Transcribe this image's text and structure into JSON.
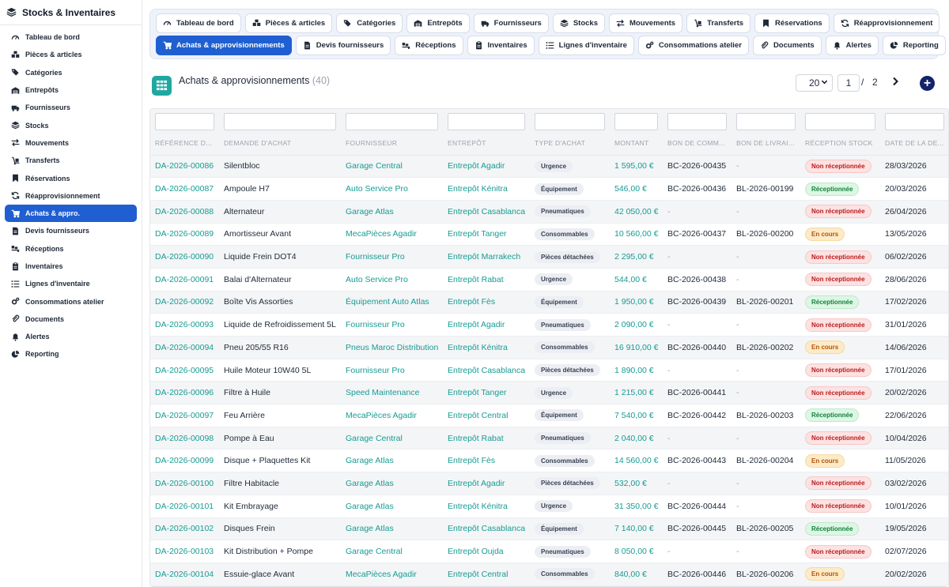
{
  "sidebar": {
    "title": "Stocks & Inventaires",
    "items": [
      {
        "label": "Tableau de bord",
        "icon": "gauge-icon",
        "active": false
      },
      {
        "label": "Pièces & articles",
        "icon": "boxes-icon",
        "active": false
      },
      {
        "label": "Catégories",
        "icon": "tags-icon",
        "active": false
      },
      {
        "label": "Entrepôts",
        "icon": "warehouse-icon",
        "active": false
      },
      {
        "label": "Fournisseurs",
        "icon": "truck-icon",
        "active": false
      },
      {
        "label": "Stocks",
        "icon": "layers-icon",
        "active": false
      },
      {
        "label": "Mouvements",
        "icon": "exchange-icon",
        "active": false
      },
      {
        "label": "Transferts",
        "icon": "dolly-icon",
        "active": false
      },
      {
        "label": "Réservations",
        "icon": "bookmark-icon",
        "active": false
      },
      {
        "label": "Réapprovisionnement",
        "icon": "sync-icon",
        "active": false
      },
      {
        "label": "Achats & appro.",
        "icon": "cart-icon",
        "active": true
      },
      {
        "label": "Devis fournisseurs",
        "icon": "file-invoice-icon",
        "active": false
      },
      {
        "label": "Réceptions",
        "icon": "truck-loading-icon",
        "active": false
      },
      {
        "label": "Inventaires",
        "icon": "clipboard-icon",
        "active": false
      },
      {
        "label": "Lignes d'inventaire",
        "icon": "list-icon",
        "active": false
      },
      {
        "label": "Consommations atelier",
        "icon": "cogs-icon",
        "active": false
      },
      {
        "label": "Documents",
        "icon": "paperclip-icon",
        "active": false
      },
      {
        "label": "Alertes",
        "icon": "bell-icon",
        "active": false
      },
      {
        "label": "Reporting",
        "icon": "pie-chart-icon",
        "active": false
      }
    ]
  },
  "topnav": {
    "row1": [
      {
        "label": "Tableau de bord",
        "icon": "gauge-icon"
      },
      {
        "label": "Pièces & articles",
        "icon": "boxes-icon"
      },
      {
        "label": "Catégories",
        "icon": "tags-icon"
      },
      {
        "label": "Entrepôts",
        "icon": "warehouse-icon"
      },
      {
        "label": "Fournisseurs",
        "icon": "truck-icon"
      },
      {
        "label": "Stocks",
        "icon": "layers-icon"
      },
      {
        "label": "Mouvements",
        "icon": "exchange-icon"
      },
      {
        "label": "Transferts",
        "icon": "dolly-icon"
      },
      {
        "label": "Réservations",
        "icon": "bookmark-icon"
      },
      {
        "label": "Réapprovisionnement",
        "icon": "sync-icon"
      }
    ],
    "row2": [
      {
        "label": "Achats & approvisionnements",
        "icon": "cart-icon",
        "active": true
      },
      {
        "label": "Devis fournisseurs",
        "icon": "file-invoice-icon"
      },
      {
        "label": "Réceptions",
        "icon": "truck-loading-icon"
      },
      {
        "label": "Inventaires",
        "icon": "clipboard-icon"
      },
      {
        "label": "Lignes d'inventaire",
        "icon": "list-icon"
      },
      {
        "label": "Consommations atelier",
        "icon": "cogs-icon"
      },
      {
        "label": "Documents",
        "icon": "paperclip-icon"
      },
      {
        "label": "Alertes",
        "icon": "bell-icon"
      },
      {
        "label": "Reporting",
        "icon": "pie-chart-icon"
      }
    ]
  },
  "header": {
    "title": "Achats & approvisionnements",
    "count": "(40)",
    "per_page": "20",
    "page": "1",
    "page_sep": "/",
    "page_total": "2",
    "next": "›",
    "add": "+"
  },
  "table": {
    "columns": [
      "RÉFÉRENCE D...",
      "DEMANDE D'ACHAT",
      "FOURNISSEUR",
      "ENTREPÔT",
      "TYPE D'ACHAT",
      "MONTANT",
      "BON DE COMM...",
      "BON DE LIVRAI...",
      "RÉCEPTION STOCK",
      "DATE DE LA DE..."
    ],
    "rows": [
      {
        "ref": "DA-2026-00086",
        "demande": "Silentbloc",
        "fournisseur": "Garage Central",
        "entrepot": "Entrepôt Agadir",
        "type": "Urgence",
        "montant": "1 595,00 €",
        "bc": "BC-2026-00435",
        "bl": "-",
        "statut": "Non réceptionnée",
        "date": "28/03/2026"
      },
      {
        "ref": "DA-2026-00087",
        "demande": "Ampoule H7",
        "fournisseur": "Auto Service Pro",
        "entrepot": "Entrepôt Kénitra",
        "type": "Équipement",
        "montant": "546,00 €",
        "bc": "BC-2026-00436",
        "bl": "BL-2026-00199",
        "statut": "Réceptionnée",
        "date": "20/03/2026"
      },
      {
        "ref": "DA-2026-00088",
        "demande": "Alternateur",
        "fournisseur": "Garage Atlas",
        "entrepot": "Entrepôt Casablanca",
        "type": "Pneumatiques",
        "montant": "42 050,00 €",
        "bc": "-",
        "bl": "-",
        "statut": "Non réceptionnée",
        "date": "26/04/2026"
      },
      {
        "ref": "DA-2026-00089",
        "demande": "Amortisseur Avant",
        "fournisseur": "MecaPièces Agadir",
        "entrepot": "Entrepôt Tanger",
        "type": "Consommables",
        "montant": "10 560,00 €",
        "bc": "BC-2026-00437",
        "bl": "BL-2026-00200",
        "statut": "En cours",
        "date": "13/05/2026"
      },
      {
        "ref": "DA-2026-00090",
        "demande": "Liquide Frein DOT4",
        "fournisseur": "Fournisseur Pro",
        "entrepot": "Entrepôt Marrakech",
        "type": "Pièces détachées",
        "montant": "2 295,00 €",
        "bc": "-",
        "bl": "-",
        "statut": "Non réceptionnée",
        "date": "06/02/2026"
      },
      {
        "ref": "DA-2026-00091",
        "demande": "Balai d'Alternateur",
        "fournisseur": "Auto Service Pro",
        "entrepot": "Entrepôt Rabat",
        "type": "Urgence",
        "montant": "544,00 €",
        "bc": "BC-2026-00438",
        "bl": "-",
        "statut": "Non réceptionnée",
        "date": "28/06/2026"
      },
      {
        "ref": "DA-2026-00092",
        "demande": "Boîte Vis Assorties",
        "fournisseur": "Équipement Auto Atlas",
        "entrepot": "Entrepôt Fès",
        "type": "Équipement",
        "montant": "1 950,00 €",
        "bc": "BC-2026-00439",
        "bl": "BL-2026-00201",
        "statut": "Réceptionnée",
        "date": "17/02/2026"
      },
      {
        "ref": "DA-2026-00093",
        "demande": "Liquide de Refroidissement 5L",
        "fournisseur": "Fournisseur Pro",
        "entrepot": "Entrepôt Agadir",
        "type": "Pneumatiques",
        "montant": "2 090,00 €",
        "bc": "-",
        "bl": "-",
        "statut": "Non réceptionnée",
        "date": "31/01/2026"
      },
      {
        "ref": "DA-2026-00094",
        "demande": "Pneu 205/55 R16",
        "fournisseur": "Pneus Maroc Distribution",
        "entrepot": "Entrepôt Kénitra",
        "type": "Consommables",
        "montant": "16 910,00 €",
        "bc": "BC-2026-00440",
        "bl": "BL-2026-00202",
        "statut": "En cours",
        "date": "14/06/2026"
      },
      {
        "ref": "DA-2026-00095",
        "demande": "Huile Moteur 10W40 5L",
        "fournisseur": "Fournisseur Pro",
        "entrepot": "Entrepôt Casablanca",
        "type": "Pièces détachées",
        "montant": "1 890,00 €",
        "bc": "-",
        "bl": "-",
        "statut": "Non réceptionnée",
        "date": "17/01/2026"
      },
      {
        "ref": "DA-2026-00096",
        "demande": "Filtre à Huile",
        "fournisseur": "Speed Maintenance",
        "entrepot": "Entrepôt Tanger",
        "type": "Urgence",
        "montant": "1 215,00 €",
        "bc": "BC-2026-00441",
        "bl": "-",
        "statut": "Non réceptionnée",
        "date": "20/02/2026"
      },
      {
        "ref": "DA-2026-00097",
        "demande": "Feu Arrière",
        "fournisseur": "MecaPièces Agadir",
        "entrepot": "Entrepôt Central",
        "type": "Équipement",
        "montant": "7 540,00 €",
        "bc": "BC-2026-00442",
        "bl": "BL-2026-00203",
        "statut": "Réceptionnée",
        "date": "22/06/2026"
      },
      {
        "ref": "DA-2026-00098",
        "demande": "Pompe à Eau",
        "fournisseur": "Garage Central",
        "entrepot": "Entrepôt Rabat",
        "type": "Pneumatiques",
        "montant": "2 040,00 €",
        "bc": "-",
        "bl": "-",
        "statut": "Non réceptionnée",
        "date": "10/04/2026"
      },
      {
        "ref": "DA-2026-00099",
        "demande": "Disque + Plaquettes Kit",
        "fournisseur": "Garage Atlas",
        "entrepot": "Entrepôt Fès",
        "type": "Consommables",
        "montant": "14 560,00 €",
        "bc": "BC-2026-00443",
        "bl": "BL-2026-00204",
        "statut": "En cours",
        "date": "11/05/2026"
      },
      {
        "ref": "DA-2026-00100",
        "demande": "Filtre Habitacle",
        "fournisseur": "Garage Atlas",
        "entrepot": "Entrepôt Agadir",
        "type": "Pièces détachées",
        "montant": "532,00 €",
        "bc": "-",
        "bl": "-",
        "statut": "Non réceptionnée",
        "date": "03/02/2026"
      },
      {
        "ref": "DA-2026-00101",
        "demande": "Kit Embrayage",
        "fournisseur": "Garage Atlas",
        "entrepot": "Entrepôt Kénitra",
        "type": "Urgence",
        "montant": "31 350,00 €",
        "bc": "BC-2026-00444",
        "bl": "-",
        "statut": "Non réceptionnée",
        "date": "10/01/2026"
      },
      {
        "ref": "DA-2026-00102",
        "demande": "Disques Frein",
        "fournisseur": "Garage Atlas",
        "entrepot": "Entrepôt Casablanca",
        "type": "Équipement",
        "montant": "7 140,00 €",
        "bc": "BC-2026-00445",
        "bl": "BL-2026-00205",
        "statut": "Réceptionnée",
        "date": "19/05/2026"
      },
      {
        "ref": "DA-2026-00103",
        "demande": "Kit Distribution + Pompe",
        "fournisseur": "Garage Central",
        "entrepot": "Entrepôt Oujda",
        "type": "Pneumatiques",
        "montant": "8 050,00 €",
        "bc": "-",
        "bl": "-",
        "statut": "Non réceptionnée",
        "date": "02/07/2026"
      },
      {
        "ref": "DA-2026-00104",
        "demande": "Essuie-glace Avant",
        "fournisseur": "MecaPièces Agadir",
        "entrepot": "Entrepôt Central",
        "type": "Consommables",
        "montant": "840,00 €",
        "bc": "BC-2026-00446",
        "bl": "BL-2026-00206",
        "statut": "En cours",
        "date": "20/02/2026"
      }
    ]
  },
  "colors": {
    "accent": "#1f5fd1",
    "teal": "#169c92",
    "status_non": "#b91c1c",
    "status_ok": "#15803d",
    "status_cours": "#b45309"
  }
}
